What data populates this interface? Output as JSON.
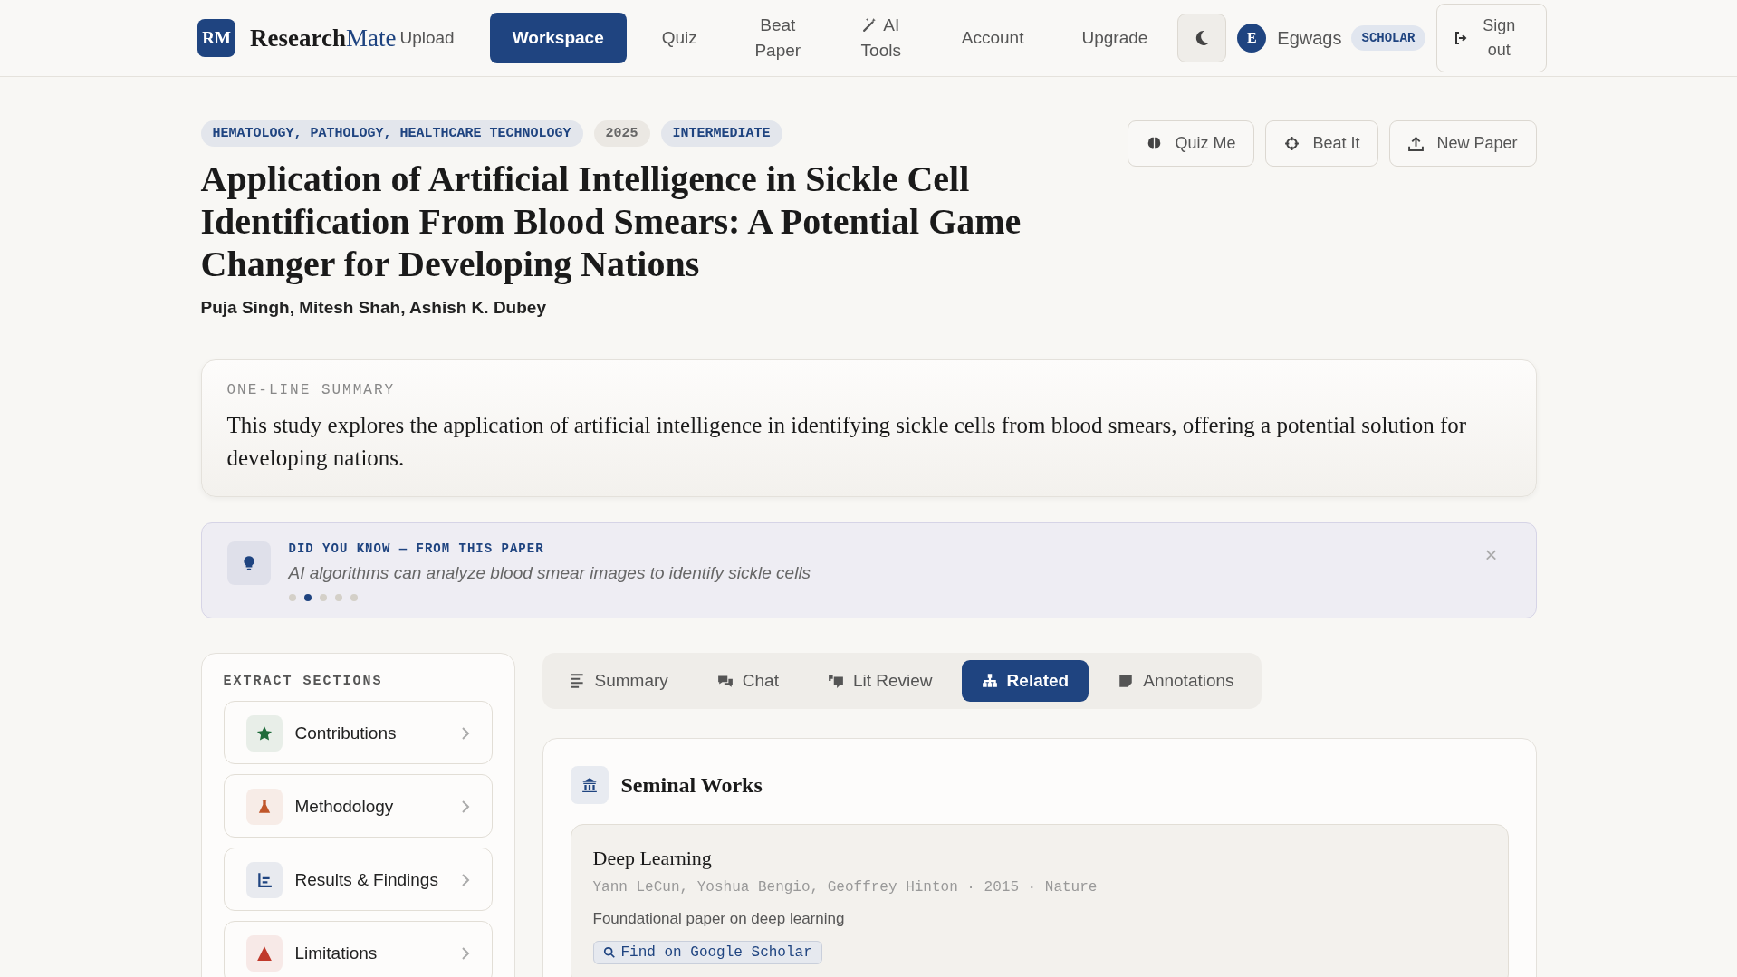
{
  "brand": {
    "mark": "RM",
    "name_main": "Research",
    "name_accent": "Mate"
  },
  "nav": [
    {
      "label": "Upload",
      "selected": false
    },
    {
      "label": "Workspace",
      "selected": true
    },
    {
      "label": "Quiz",
      "selected": false
    },
    {
      "label": "Beat Paper",
      "selected": false
    },
    {
      "label": "AI Tools",
      "selected": false,
      "icon": true
    },
    {
      "label": "Account",
      "selected": false
    },
    {
      "label": "Upgrade",
      "selected": false
    }
  ],
  "user": {
    "initial": "E",
    "name": "Egwags",
    "plan": "SCHOLAR",
    "sign_out": "Sign out"
  },
  "paper": {
    "tags": [
      {
        "label": "HEMATOLOGY, PATHOLOGY, HEALTHCARE TECHNOLOGY",
        "kind": "topic"
      },
      {
        "label": "2025",
        "kind": "year"
      },
      {
        "label": "INTERMEDIATE",
        "kind": "topic"
      }
    ],
    "title": "Application of Artificial Intelligence in Sickle Cell Identification From Blood Smears: A Potential Game Changer for Developing Nations",
    "authors": "Puja Singh, Mitesh Shah, Ashish K. Dubey",
    "actions": [
      "Quiz Me",
      "Beat It",
      "New Paper"
    ]
  },
  "summary": {
    "label": "ONE-LINE SUMMARY",
    "text": "This study explores the application of artificial intelligence in identifying sickle cells from blood smears, offering a potential solution for developing nations."
  },
  "did_you_know": {
    "label": "DID YOU KNOW — FROM THIS PAPER",
    "text": "AI algorithms can analyze blood smear images to identify sickle cells",
    "close": "×",
    "dots": [
      {
        "selected": false
      },
      {
        "selected": true
      },
      {
        "selected": false
      },
      {
        "selected": false
      },
      {
        "selected": false
      }
    ]
  },
  "sidebar": {
    "title": "EXTRACT SECTIONS",
    "items": [
      {
        "label": "Contributions",
        "color": "#1e6b3a"
      },
      {
        "label": "Methodology",
        "color": "#c0562a"
      },
      {
        "label": "Results & Findings",
        "color": "#1f4480"
      },
      {
        "label": "Limitations",
        "color": "#c0392b"
      }
    ]
  },
  "tabs": [
    {
      "label": "Summary",
      "selected": false
    },
    {
      "label": "Chat",
      "selected": false
    },
    {
      "label": "Lit Review",
      "selected": false
    },
    {
      "label": "Related",
      "selected": true
    },
    {
      "label": "Annotations",
      "selected": false
    }
  ],
  "related": {
    "heading": "Seminal Works",
    "works": [
      {
        "title": "Deep Learning",
        "meta": "Yann LeCun, Yoshua Bengio, Geoffrey Hinton · 2015 · Nature",
        "description": "Foundational paper on deep learning",
        "link": "Find on Google Scholar"
      }
    ]
  }
}
